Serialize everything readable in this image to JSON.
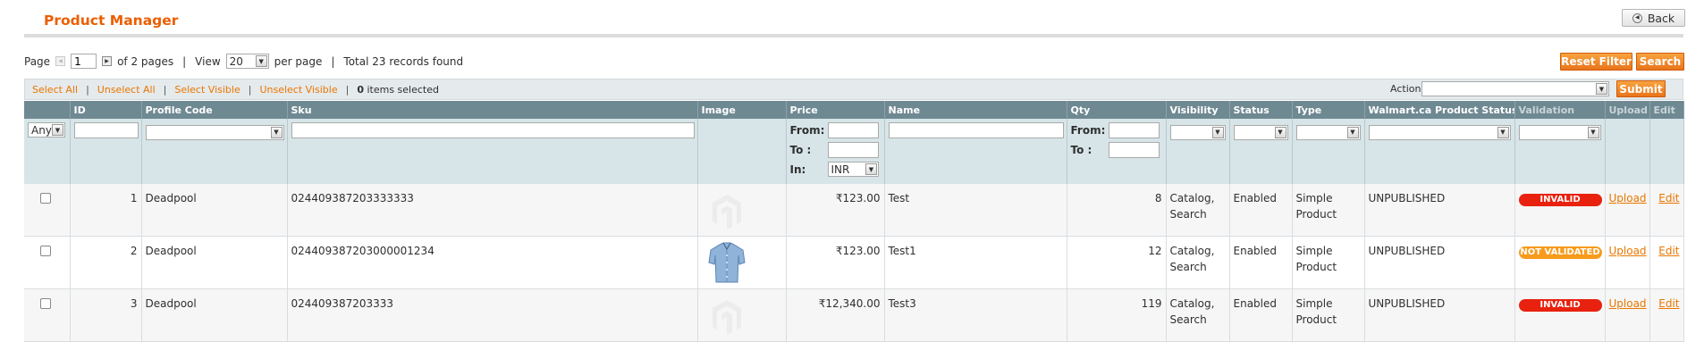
{
  "header": {
    "title": "Product Manager",
    "back_label": "Back"
  },
  "pager": {
    "page_label": "Page",
    "page_value": "1",
    "of_pages": "of 2 pages",
    "view_label": "View",
    "view_value": "20",
    "per_page": "per page",
    "total": "Total 23 records found"
  },
  "actions": {
    "reset_filter": "Reset Filter",
    "search": "Search",
    "actions_label": "Actions",
    "actions_value": "",
    "submit": "Submit"
  },
  "massaction": {
    "select_all": "Select All",
    "unselect_all": "Unselect All",
    "select_visible": "Select Visible",
    "unselect_visible": "Unselect Visible",
    "items_selected_count": "0",
    "items_selected_text": "items selected"
  },
  "columns": [
    "",
    "ID",
    "Profile Code",
    "Sku",
    "Image",
    "Price",
    "Name",
    "Qty",
    "Visibility",
    "Status",
    "Type",
    "Walmart.ca Product Status",
    "Validation",
    "Upload",
    "Edit"
  ],
  "filters": {
    "any": "Any",
    "from": "From:",
    "to": "To :",
    "in": "In:",
    "currency": "INR"
  },
  "rows": [
    {
      "id": "1",
      "profile": "Deadpool",
      "sku": "024409387203333333",
      "image": "placeholder",
      "price": "₹123.00",
      "name": "Test",
      "qty": "8",
      "vis1": "Catalog,",
      "vis2": "Search",
      "status": "Enabled",
      "type1": "Simple",
      "type2": "Product",
      "wstatus": "UNPUBLISHED",
      "validation": "INVALID",
      "validation_color": "#e8220f",
      "upload": "Upload",
      "edit": "Edit"
    },
    {
      "id": "2",
      "profile": "Deadpool",
      "sku": "024409387203000001234",
      "image": "shirt",
      "price": "₹123.00",
      "name": "Test1",
      "qty": "12",
      "vis1": "Catalog,",
      "vis2": "Search",
      "status": "Enabled",
      "type1": "Simple",
      "type2": "Product",
      "wstatus": "UNPUBLISHED",
      "validation": "NOT VALIDATED",
      "validation_color": "#f79b1c",
      "upload": "Upload",
      "edit": "Edit"
    },
    {
      "id": "3",
      "profile": "Deadpool",
      "sku": "024409387203333",
      "image": "placeholder",
      "price": "₹12,340.00",
      "name": "Test3",
      "qty": "119",
      "vis1": "Catalog,",
      "vis2": "Search",
      "status": "Enabled",
      "type1": "Simple",
      "type2": "Product",
      "wstatus": "UNPUBLISHED",
      "validation": "INVALID",
      "validation_color": "#e8220f",
      "upload": "Upload",
      "edit": "Edit"
    }
  ]
}
